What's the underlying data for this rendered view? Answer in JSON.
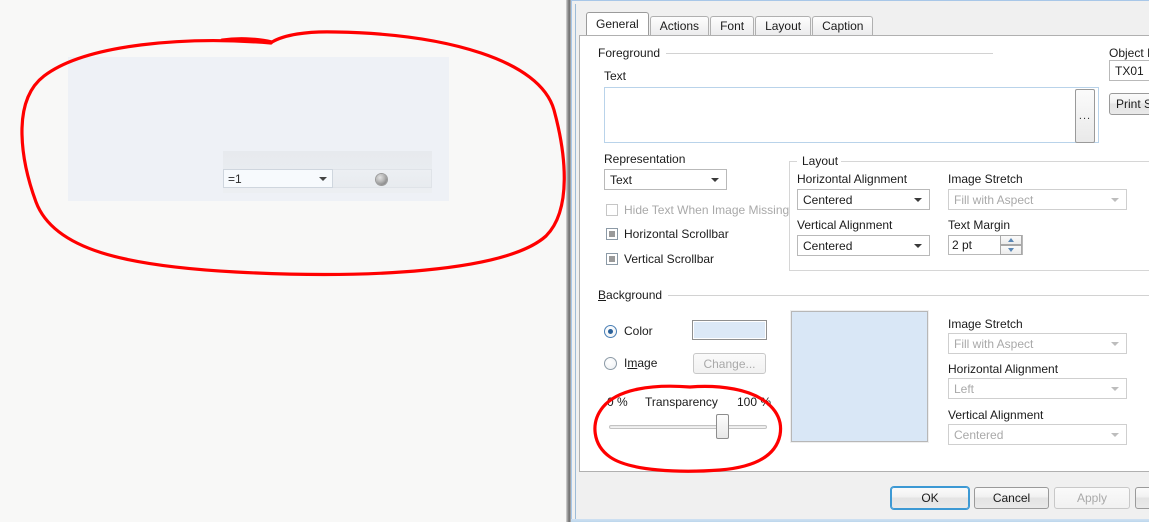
{
  "host": {
    "panel_name": "design-canvas",
    "widget": {
      "combo_value": "=1",
      "indicator_name": "status-led"
    }
  },
  "annotations": {
    "color": "#ff0000",
    "shapes": [
      "ellipse-around-widget",
      "ellipse-around-transparency-slider"
    ]
  },
  "dialog": {
    "tabs": [
      {
        "label": "General",
        "active": true
      },
      {
        "label": "Actions",
        "active": false
      },
      {
        "label": "Font",
        "active": false
      },
      {
        "label": "Layout",
        "active": false
      },
      {
        "label": "Caption",
        "active": false
      }
    ],
    "object_id": {
      "label": "Object I",
      "value": "TX01"
    },
    "print_button": "Print S",
    "foreground": {
      "group_label": "Foreground",
      "text_label": "Text",
      "text_value": "",
      "text_placeholder": "",
      "browse_label": "...",
      "representation": {
        "label": "Representation",
        "value": "Text"
      },
      "checkboxes": [
        {
          "label": "Hide Text When Image Missing",
          "checked": false,
          "disabled": true
        },
        {
          "label": "Horizontal Scrollbar",
          "checked": true,
          "disabled": false
        },
        {
          "label": "Vertical Scrollbar",
          "checked": true,
          "disabled": false
        }
      ],
      "layout": {
        "group_label": "Layout",
        "horizontal_alignment": {
          "label": "Horizontal Alignment",
          "value": "Centered"
        },
        "vertical_alignment": {
          "label": "Vertical Alignment",
          "value": "Centered"
        },
        "image_stretch": {
          "label": "Image Stretch",
          "value": "Fill with Aspect",
          "disabled": true
        },
        "text_margin": {
          "label": "Text Margin",
          "value": "2 pt"
        }
      }
    },
    "background": {
      "group_label": "Background",
      "group_label_accel": "B",
      "group_label_rest": "ackground",
      "color_radio": {
        "label": "Color",
        "selected": true
      },
      "image_radio": {
        "label": "Image",
        "selected": false
      },
      "color_swatch_hex": "#dce9f7",
      "change_button": {
        "label": "Change...",
        "disabled": true
      },
      "preview_hex": "#d9e7f6",
      "transparency": {
        "label": "Transparency",
        "min_label": "0 %",
        "max_label": "100 %",
        "value": 68
      },
      "image_stretch": {
        "label": "Image Stretch",
        "value": "Fill with Aspect",
        "disabled": true
      },
      "horizontal_alignment": {
        "label": "Horizontal Alignment",
        "value": "Left",
        "disabled": true
      },
      "vertical_alignment": {
        "label": "Vertical Alignment",
        "value": "Centered",
        "disabled": true
      }
    },
    "footer": {
      "ok": "OK",
      "cancel": "Cancel",
      "apply": "Apply",
      "apply_disabled": true
    }
  }
}
